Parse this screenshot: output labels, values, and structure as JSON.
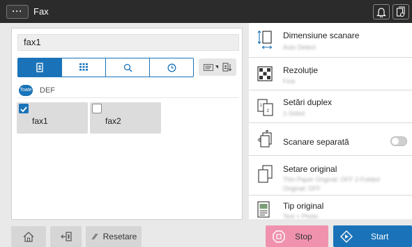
{
  "app": {
    "title": "Fax",
    "menu_label": "···"
  },
  "address": {
    "value": "fax1"
  },
  "filter": {
    "all_label": "Toate",
    "group_label": "DEF"
  },
  "destinations": [
    {
      "label": "fax1",
      "checked": true
    },
    {
      "label": "fax2",
      "checked": false
    }
  ],
  "settings": [
    {
      "label": "Dimensiune scanare",
      "value": "Auto Detect",
      "icon": "scan-size-icon"
    },
    {
      "label": "Rezoluție",
      "value": "Fine",
      "icon": "resolution-icon"
    },
    {
      "label": "Setări duplex",
      "value": "1-Sided",
      "icon": "duplex-icon"
    },
    {
      "label": "Scanare separată",
      "value": "",
      "icon": "separate-scan-icon",
      "toggle": false
    },
    {
      "label": "Setare original",
      "value": "Thin Paper Original: OFF 2-Folded Original: OFF",
      "icon": "original-settings-icon"
    },
    {
      "label": "Tip original",
      "value": "Text + Photo",
      "icon": "original-type-icon"
    }
  ],
  "footer": {
    "reset_label": "Resetare",
    "stop_label": "Stop",
    "start_label": "Start"
  },
  "colors": {
    "accent": "#1a73b8",
    "stop": "#f092ae",
    "topbar": "#2b2b2b"
  }
}
